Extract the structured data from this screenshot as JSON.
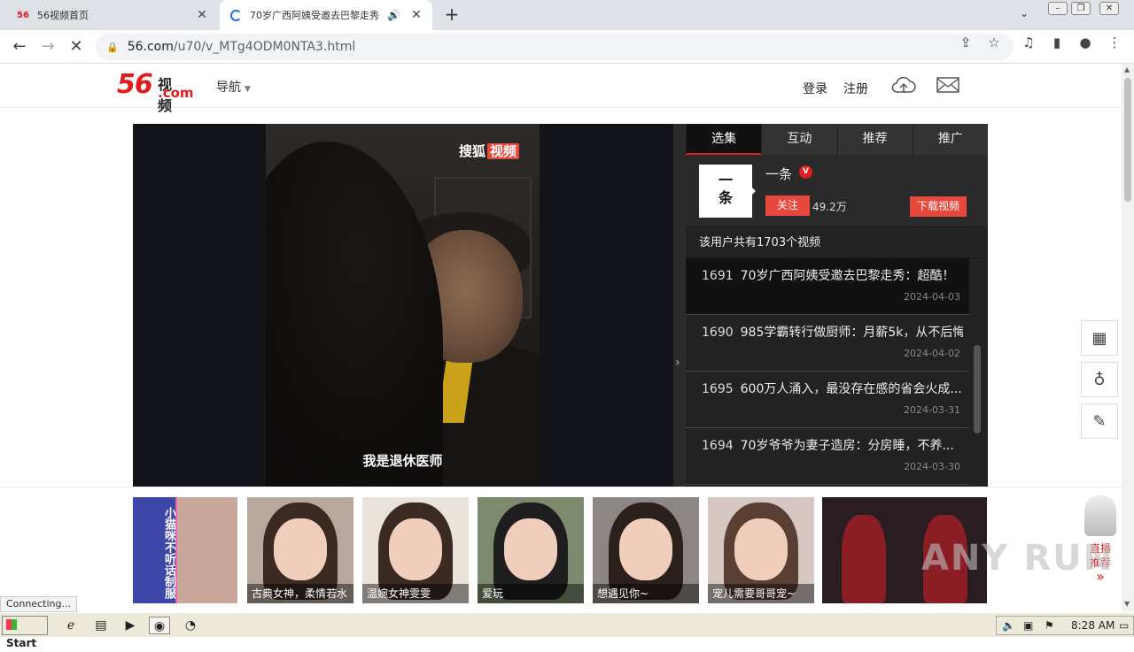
{
  "browser": {
    "tabs": [
      {
        "favicon_text": "56",
        "title": "56视频首页",
        "close": "✕"
      },
      {
        "title": "70岁广西阿姨受邀去巴黎走秀",
        "audio_icon": "speaker-icon",
        "close": "✕"
      }
    ],
    "new_tab": "+",
    "url_host": "56.com",
    "url_path": "/u70/v_MTg4ODM0NTA3.html"
  },
  "site": {
    "logo_num": "56",
    "logo_word": "视频",
    "logo_com": ".com",
    "nav_label": "导航",
    "login": "登录",
    "register": "注册"
  },
  "player": {
    "brand_text": "搜狐",
    "brand_box": "视频",
    "subtitle": "我是退休医师"
  },
  "panel": {
    "tabs": [
      "选集",
      "互动",
      "推荐",
      "推广"
    ],
    "uploader_avatar": "一\n条",
    "uploader_name": "一条",
    "verified": "V",
    "follow_label": "关注",
    "fans": "49.2万",
    "download_label": "下载视频",
    "total_text": "该用户共有1703个视频",
    "items": [
      {
        "num": "1691",
        "title": "70岁广西阿姨受邀去巴黎走秀：超酷！",
        "date": "2024-04-03"
      },
      {
        "num": "1690",
        "title": "985学霸转行做厨师：月薪5k，从不后悔",
        "date": "2024-04-02"
      },
      {
        "num": "1695",
        "title": "600万人涌入，最没存在感的省会火成...",
        "date": "2024-03-31"
      },
      {
        "num": "1694",
        "title": "70岁爷爷为妻子造房：分房睡，不养...",
        "date": "2024-03-30"
      }
    ]
  },
  "ads": {
    "first_text": "小猫咪不听话制服",
    "cards": [
      {
        "caption": "古典女神，柔情若水"
      },
      {
        "caption": "温婉女神雯雯"
      },
      {
        "caption": "爱玩"
      },
      {
        "caption": "想遇见你~"
      },
      {
        "caption": "宠儿需要哥哥宠~"
      }
    ],
    "live_label": "直播",
    "recommend_label": "推荐",
    "more": "»"
  },
  "status": {
    "connecting": "Connecting..."
  },
  "watermark": "ANY RUN",
  "taskbar": {
    "start": "Start",
    "clock": "8:28 AM"
  }
}
